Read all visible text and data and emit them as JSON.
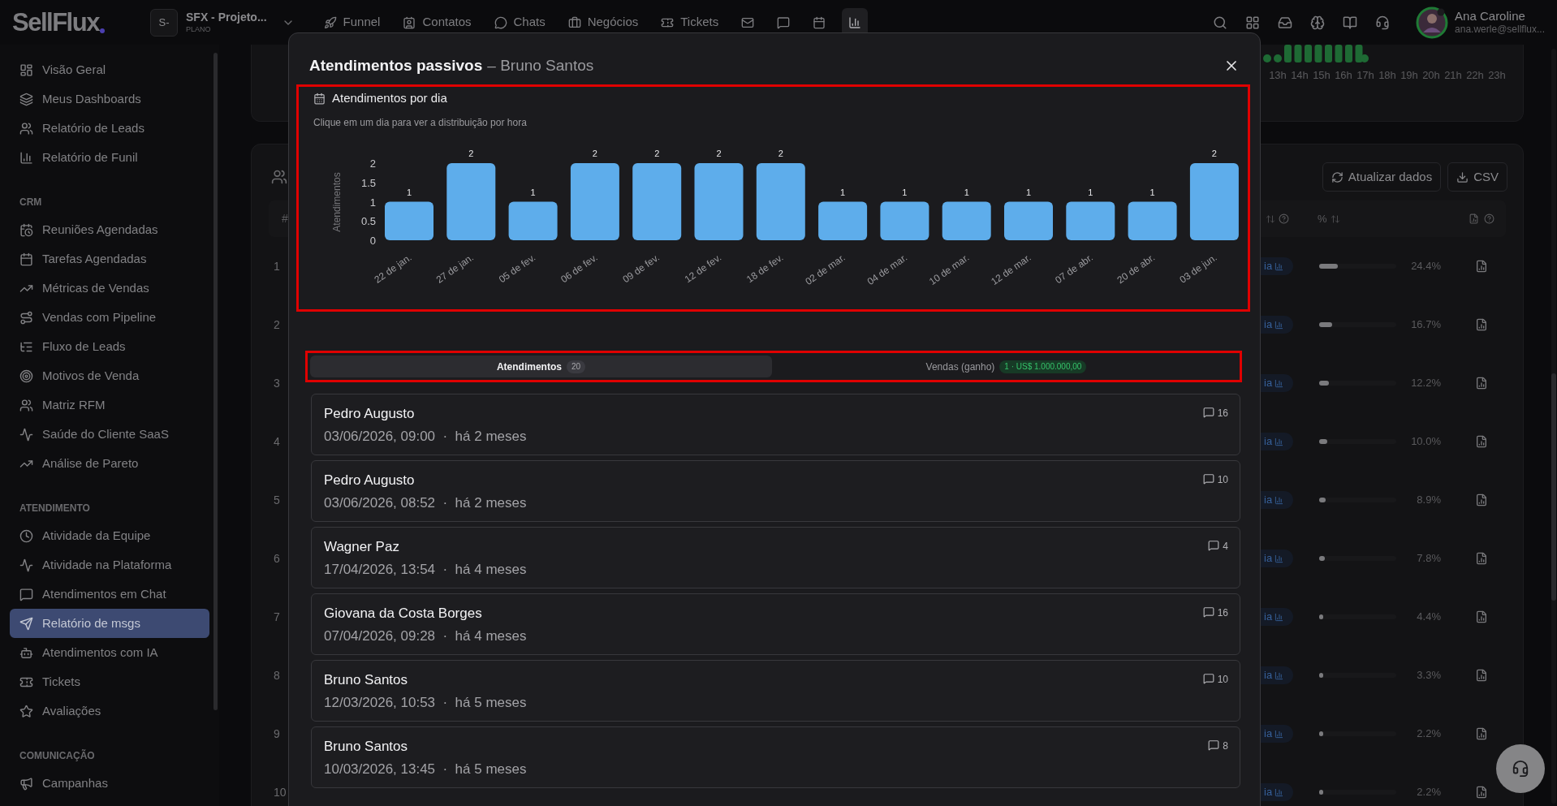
{
  "topbar": {
    "logo": "SellFlux",
    "workspace": {
      "initials": "S-",
      "name": "SFX - Projeto...",
      "plan": "PLANO"
    },
    "nav": [
      {
        "label": "Funnel",
        "selected": false
      },
      {
        "label": "Contatos",
        "selected": false
      },
      {
        "label": "Chats",
        "selected": false
      },
      {
        "label": "Negócios",
        "selected": false
      },
      {
        "label": "Tickets",
        "selected": false
      },
      {
        "selected": false
      },
      {
        "selected": false
      },
      {
        "selected": false
      },
      {
        "selected": true
      }
    ],
    "user": {
      "name": "Ana Caroline",
      "email": "ana.werle@sellflux..."
    }
  },
  "sidebar": {
    "groups": [
      {
        "items": [
          {
            "label": "Visão Geral",
            "selected": false
          },
          {
            "label": "Meus Dashboards",
            "selected": false
          },
          {
            "label": "Relatório de Leads",
            "selected": false
          },
          {
            "label": "Relatório de Funil",
            "selected": false
          }
        ]
      },
      {
        "title": "CRM",
        "items": [
          {
            "label": "Reuniões Agendadas",
            "selected": false
          },
          {
            "label": "Tarefas Agendadas",
            "selected": false
          },
          {
            "label": "Métricas de Vendas",
            "selected": false
          },
          {
            "label": "Vendas com Pipeline",
            "selected": false
          },
          {
            "label": "Fluxo de Leads",
            "selected": false
          },
          {
            "label": "Motivos de Venda",
            "selected": false
          },
          {
            "label": "Matriz RFM",
            "selected": false
          },
          {
            "label": "Saúde do Cliente SaaS",
            "selected": false
          },
          {
            "label": "Análise de Pareto",
            "selected": false
          }
        ]
      },
      {
        "title": "ATENDIMENTO",
        "items": [
          {
            "label": "Atividade da Equipe",
            "selected": false
          },
          {
            "label": "Atividade na Plataforma",
            "selected": false
          },
          {
            "label": "Atendimentos em Chat",
            "selected": false
          },
          {
            "label": "Relatório de msgs",
            "selected": true
          },
          {
            "label": "Atendimentos com IA",
            "selected": false
          },
          {
            "label": "Tickets",
            "selected": false
          },
          {
            "label": "Avaliações",
            "selected": false
          }
        ]
      },
      {
        "title": "COMUNICAÇÃO",
        "items": [
          {
            "label": "Campanhas",
            "selected": false
          }
        ]
      }
    ]
  },
  "background": {
    "hours": [
      "13h",
      "14h",
      "15h",
      "16h",
      "17h",
      "18h",
      "19h",
      "20h",
      "21h",
      "22h",
      "23h"
    ],
    "buttons": [
      "Atualizar dados",
      "CSV"
    ],
    "table": {
      "number_header": "#",
      "percent_header": "%",
      "rows": [
        {
          "number": "1",
          "badge": "ia",
          "level": 0.244,
          "percent": "24.4%"
        },
        {
          "number": "2",
          "badge": "ia",
          "level": 0.167,
          "percent": "16.7%"
        },
        {
          "number": "3",
          "badge": "ia",
          "level": 0.122,
          "percent": "12.2%"
        },
        {
          "number": "4",
          "badge": "ia",
          "level": 0.1,
          "percent": "10.0%"
        },
        {
          "number": "5",
          "badge": "ia",
          "level": 0.089,
          "percent": "8.9%"
        },
        {
          "number": "6",
          "badge": "ia",
          "level": 0.078,
          "percent": "7.8%"
        },
        {
          "number": "7",
          "badge": "ia",
          "level": 0.044,
          "percent": "4.4%"
        },
        {
          "number": "8",
          "badge": "ia",
          "level": 0.033,
          "percent": "3.3%"
        },
        {
          "number": "9",
          "badge": "ia",
          "level": 0.022,
          "percent": "2.2%"
        },
        {
          "number": "10",
          "badge": "ia",
          "level": 0.022,
          "percent": "2.2%"
        }
      ]
    }
  },
  "modal": {
    "title": "Atendimentos passivos",
    "subtitle": "– Bruno Santos",
    "chart_panel": {
      "title": "Atendimentos por dia",
      "hint": "Clique em um dia para ver a distribuição por hora",
      "highlighted": true,
      "chart_data": {
        "type": "bar",
        "ylabel": "Atendimentos",
        "categories": [
          "22 de jan.",
          "27 de jan.",
          "05 de fev.",
          "06 de fev.",
          "09 de fev.",
          "12 de fev.",
          "18 de fev.",
          "02 de mar.",
          "04 de mar.",
          "10 de mar.",
          "12 de mar.",
          "07 de abr.",
          "20 de abr.",
          "03 de jun."
        ],
        "series": [
          {
            "color": "#5eadeb",
            "values": [
              1,
              2,
              1,
              2,
              2,
              2,
              2,
              1,
              1,
              1,
              1,
              1,
              1,
              2
            ]
          }
        ],
        "yticks": [
          0,
          0.5,
          1,
          1.5,
          2
        ],
        "ylim": [
          0,
          2
        ],
        "data_labels": true
      }
    },
    "tabs_highlighted": true,
    "tabs": [
      {
        "label": "Atendimentos",
        "badge": "20",
        "kind": "count",
        "selected": true
      },
      {
        "label": "Vendas (ganho)",
        "badge": "1 · US$ 1.000.000,00",
        "kind": "money",
        "selected": false
      }
    ],
    "cards": [
      {
        "name": "Pedro Augusto",
        "meta": "03/06/2026, 09:00  ·  há 2 meses",
        "messages": "16"
      },
      {
        "name": "Pedro Augusto",
        "meta": "03/06/2026, 08:52  ·  há 2 meses",
        "messages": "10"
      },
      {
        "name": "Wagner Paz",
        "meta": "17/04/2026, 13:54  ·  há 4 meses",
        "messages": "4"
      },
      {
        "name": "Giovana da Costa Borges",
        "meta": "07/04/2026, 09:28  ·  há 4 meses",
        "messages": "16"
      },
      {
        "name": "Bruno Santos",
        "meta": "12/03/2026, 10:53  ·  há 5 meses",
        "messages": "10"
      },
      {
        "name": "Bruno Santos",
        "meta": "10/03/2026, 13:45  ·  há 5 meses",
        "messages": "8"
      }
    ]
  }
}
